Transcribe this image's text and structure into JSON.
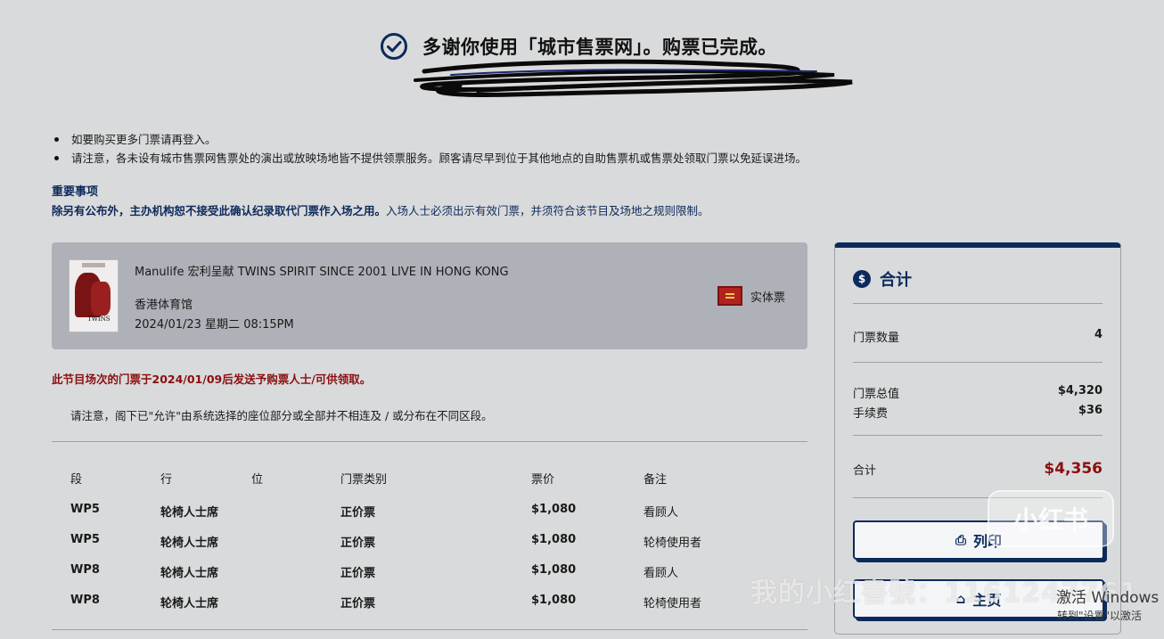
{
  "header": {
    "title": "多谢你使用「城市售票网」。购票已完成。"
  },
  "notices": [
    "如要购买更多门票请再登入。",
    "请注意，各未设有城市售票网售票处的演出或放映场地皆不提供领票服务。顾客请尽早到位于其他地点的自助售票机或售票处领取门票以免延误进场。"
  ],
  "important": {
    "heading": "重要事项",
    "bold_text": "除另有公布外，主办机构恕不接受此确认纪录取代门票作入场之用。",
    "text": "入场人士必须出示有效门票，并须符合该节目及场地之规则限制。"
  },
  "event": {
    "name": "Manulife 宏利呈献 TWINS SPIRIT SINCE 2001 LIVE IN HONG KONG",
    "venue": "香港体育馆",
    "datetime": "2024/01/23 星期二 08:15PM",
    "ticket_type": "实体票",
    "poster_text": "TWINS"
  },
  "dispatch_note": "此节目场次的门票于2024/01/09后发送予购票人士/可供领取。",
  "seat_note": "请注意，阁下已\"允许\"由系统选择的座位部分或全部并不相连及 / 或分布在不同区段。",
  "seats": {
    "headers": [
      "段",
      "行",
      "位",
      "门票类别",
      "票价",
      "备注"
    ],
    "rows": [
      [
        "WP5",
        "轮椅人士席",
        "",
        "正价票",
        "$1,080",
        "看顾人"
      ],
      [
        "WP5",
        "轮椅人士席",
        "",
        "正价票",
        "$1,080",
        "轮椅使用者"
      ],
      [
        "WP8",
        "轮椅人士席",
        "",
        "正价票",
        "$1,080",
        "看顾人"
      ],
      [
        "WP8",
        "轮椅人士席",
        "",
        "正价票",
        "$1,080",
        "轮椅使用者"
      ]
    ]
  },
  "summary": {
    "title": "合计",
    "qty_label": "门票数量",
    "qty_value": "4",
    "subtotal_label": "门票总值",
    "subtotal_value": "$4,320",
    "fee_label": "手续费",
    "fee_value": "$36",
    "total_label": "合计",
    "total_value": "$4,356",
    "print_label": "列印",
    "home_label": "主页"
  },
  "overlay": {
    "badge": "小红书",
    "watermark": "我的小红書號：1161247761",
    "windows_title": "激活 Windows",
    "windows_sub": "转到\"设置\"以激活"
  },
  "colors": {
    "navy": "#0c2a5b",
    "alert_red": "#8b0e0e",
    "card_bg": "#aeb1b7",
    "page_bg": "#d9dadb"
  }
}
